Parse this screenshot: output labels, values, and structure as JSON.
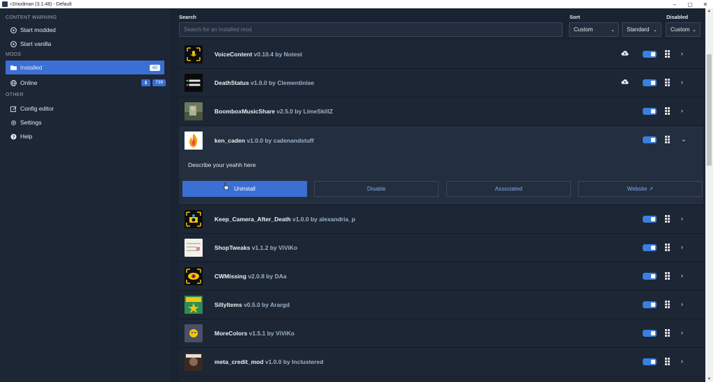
{
  "window": {
    "title": "r2modman (3.1.48) - Default",
    "controls": [
      "–",
      "▢",
      "✕"
    ]
  },
  "sidebar": {
    "content_warning": "CONTENT WARNING",
    "start_modded": "Start modded",
    "start_vanilla": "Start vanilla",
    "mods_heading": "MODS",
    "installed": "Installed",
    "installed_count": "42",
    "online": "Online",
    "online_count": "739",
    "other_heading": "OTHER",
    "config_editor": "Config editor",
    "settings": "Settings",
    "help": "Help"
  },
  "filters": {
    "search_label": "Search",
    "search_placeholder": "Search for an installed mod",
    "sort_label": "Sort",
    "sort_value": "Custom",
    "order_value": "Standard",
    "disabled_label": "Disabled",
    "disabled_value": "Custom"
  },
  "mods": [
    {
      "name": "VoiceContent",
      "version": "v0.10.4 by Notest",
      "cloud": true
    },
    {
      "name": "DeathStatus",
      "version": "v1.0.0 by Clementinise",
      "cloud": true
    },
    {
      "name": "BoomboxMusicShare",
      "version": "v2.5.0 by LimeSkillZ",
      "cloud": false
    },
    {
      "name": "ken_caden",
      "version": "v1.0.0 by cadenandstuff",
      "cloud": false,
      "expanded": true
    },
    {
      "name": "Keep_Camera_After_Death",
      "version": "v1.0.0 by alexandria_p",
      "cloud": false
    },
    {
      "name": "ShopTweaks",
      "version": "v1.1.2 by ViViKo",
      "cloud": false
    },
    {
      "name": "CWMissing",
      "version": "v2.0.8 by DAa",
      "cloud": false
    },
    {
      "name": "SillyItems",
      "version": "v0.5.0 by Arargd",
      "cloud": false
    },
    {
      "name": "MoreColors",
      "version": "v1.5.1 by ViViKo",
      "cloud": false
    },
    {
      "name": "meta_credit_mod",
      "version": "v1.0.0 by Inclustered",
      "cloud": false
    }
  ],
  "expanded": {
    "description": "Describe your yeahh here",
    "uninstall": "Uninstall",
    "disable": "Disable",
    "associated": "Associated",
    "website": "Website ↗"
  },
  "colors": {
    "accent": "#3b6fd4",
    "background": "#1a2332",
    "sidebar": "#1d2634"
  }
}
